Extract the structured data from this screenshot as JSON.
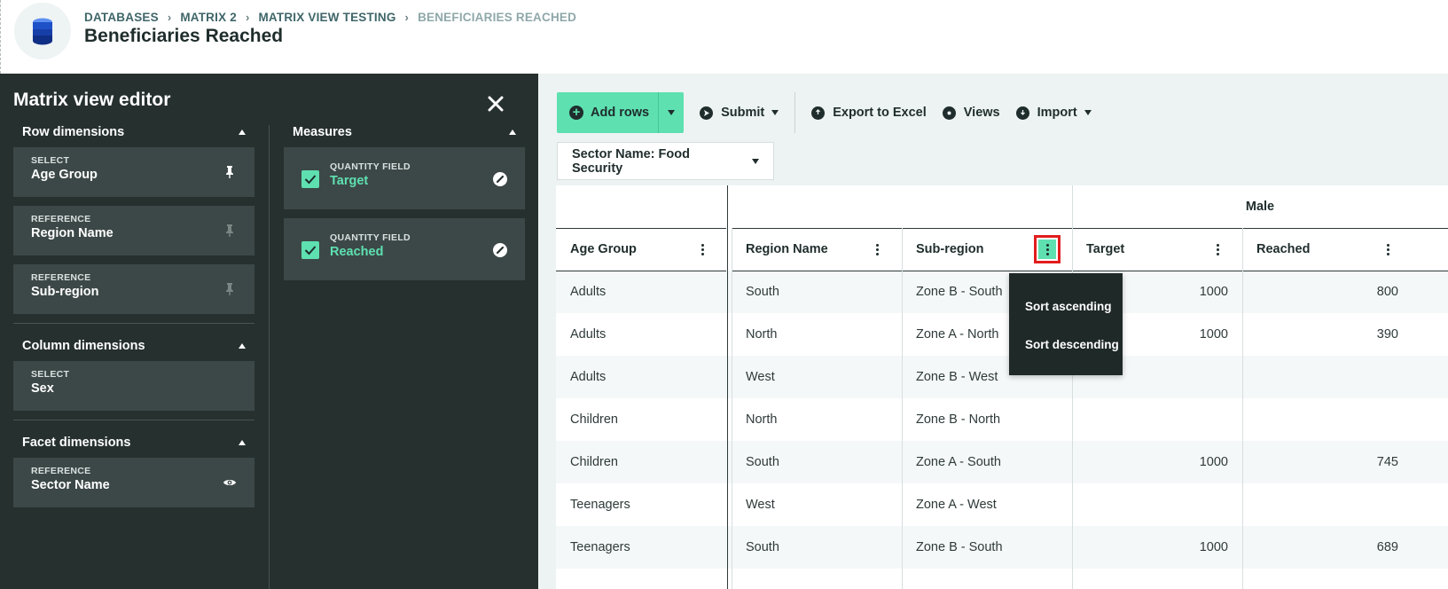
{
  "breadcrumb": [
    "DATABASES",
    "MATRIX 2",
    "MATRIX VIEW TESTING",
    "BENEFICIARIES REACHED"
  ],
  "page_title": "Beneficiaries Reached",
  "editor": {
    "title": "Matrix view editor",
    "row_dimensions": {
      "label": "Row dimensions",
      "items": [
        {
          "type": "SELECT",
          "label": "Age Group"
        },
        {
          "type": "REFERENCE",
          "label": "Region Name"
        },
        {
          "type": "REFERENCE",
          "label": "Sub-region"
        }
      ]
    },
    "column_dimensions": {
      "label": "Column dimensions",
      "items": [
        {
          "type": "SELECT",
          "label": "Sex"
        }
      ]
    },
    "facet_dimensions": {
      "label": "Facet dimensions",
      "items": [
        {
          "type": "REFERENCE",
          "label": "Sector Name"
        }
      ]
    },
    "measures": {
      "label": "Measures",
      "items": [
        {
          "type": "QUANTITY FIELD",
          "label": "Target"
        },
        {
          "type": "QUANTITY FIELD",
          "label": "Reached"
        }
      ]
    }
  },
  "toolbar": {
    "add_rows": "Add rows",
    "submit": "Submit",
    "export": "Export to Excel",
    "views": "Views",
    "import": "Import"
  },
  "facet_filter": "Sector Name: Food Security",
  "table": {
    "group_header": "Male",
    "headers": [
      "Age Group",
      "Region Name",
      "Sub-region",
      "Target",
      "Reached"
    ],
    "rows": [
      [
        "Adults",
        "South",
        "Zone B - South",
        "1000",
        "800"
      ],
      [
        "Adults",
        "North",
        "Zone A - North",
        "1000",
        "390"
      ],
      [
        "Adults",
        "West",
        "Zone B - West",
        "",
        ""
      ],
      [
        "Children",
        "North",
        "Zone B - North",
        "",
        ""
      ],
      [
        "Children",
        "South",
        "Zone A - South",
        "1000",
        "745"
      ],
      [
        "Teenagers",
        "West",
        "Zone A - West",
        "",
        ""
      ],
      [
        "Teenagers",
        "South",
        "Zone B - South",
        "1000",
        "689"
      ]
    ]
  },
  "sort_menu": [
    "Sort ascending",
    "Sort descending"
  ],
  "colors": {
    "accent": "#5ee0b1",
    "panel": "#26302f",
    "card": "#3c4847",
    "highlight": "#e11d1d"
  }
}
